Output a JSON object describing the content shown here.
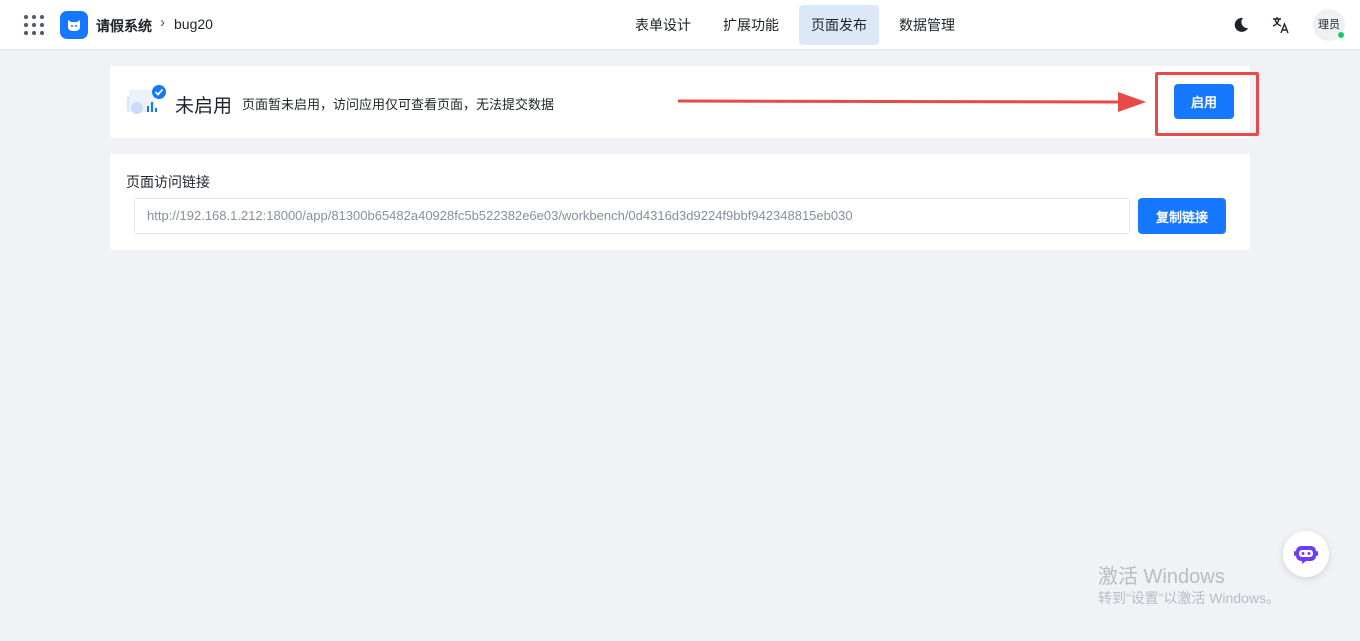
{
  "header": {
    "app_name": "请假系统",
    "breadcrumb_sep": "›",
    "page_name": "bug20",
    "nav": [
      {
        "label": "表单设计",
        "active": false
      },
      {
        "label": "扩展功能",
        "active": false
      },
      {
        "label": "页面发布",
        "active": true
      },
      {
        "label": "数据管理",
        "active": false
      }
    ],
    "avatar_text": "理员",
    "icons": [
      "apps-grid-icon",
      "app-logo-icon",
      "moon-icon",
      "translate-icon"
    ]
  },
  "status": {
    "title": "未启用",
    "description": "页面暂未启用，访问应用仅可查看页面，无法提交数据",
    "enable_label": "启用",
    "annotation_color": "#e84a4a"
  },
  "link": {
    "section_title": "页面访问链接",
    "url": "http://192.168.1.212:18000/app/81300b65482a40928fc5b522382e6e03/workbench/0d4316d3d9224f9bbf942348815eb030",
    "copy_label": "复制链接"
  },
  "watermark": {
    "title": "激活 Windows",
    "subtitle": "转到“设置”以激活 Windows。"
  },
  "colors": {
    "primary": "#1677ff",
    "active_nav_bg": "#dce8f8",
    "page_bg": "#f0f2f5"
  }
}
